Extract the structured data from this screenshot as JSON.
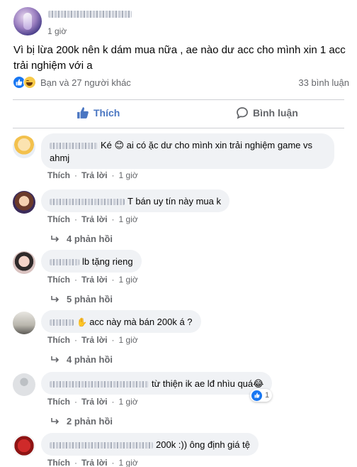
{
  "post": {
    "time": "1 giờ",
    "text": "Vì bị lừa 200k nên k dám mua nữa , ae nào dư acc cho mình xin 1 acc trải nghiệm với a",
    "reactions_text": "Bạn và 27 người khác",
    "comments_count": "33 bình luận"
  },
  "actions": {
    "like": "Thích",
    "comment": "Bình luận"
  },
  "comments": [
    {
      "text": "Ké 😊 ai có ặc dư cho mình xin trải nghiệm game vs ahmj",
      "like": "Thích",
      "reply": "Trả lời",
      "time": "1 giờ"
    },
    {
      "text": "T bán uy tín này mua k",
      "like": "Thích",
      "reply": "Trả lời",
      "time": "1 giờ",
      "replies": "4 phản hồi"
    },
    {
      "text": "lb tặng rieng",
      "like": "Thích",
      "reply": "Trả lời",
      "time": "1 giờ",
      "replies": "5 phản hồi"
    },
    {
      "text": "acc này mà bán 200k á ?",
      "like": "Thích",
      "reply": "Trả lời",
      "time": "1 giờ",
      "replies": "4 phản hồi"
    },
    {
      "text": "từ thiện ik ae lđ nhìu quá😂",
      "like": "Thích",
      "reply": "Trả lời",
      "time": "1 giờ",
      "replies": "2 phản hồi",
      "reaction_count": "1"
    },
    {
      "text": "200k :)) ông định giá tệ",
      "like": "Thích",
      "reply": "Trả lời",
      "time": "1 giờ"
    }
  ]
}
